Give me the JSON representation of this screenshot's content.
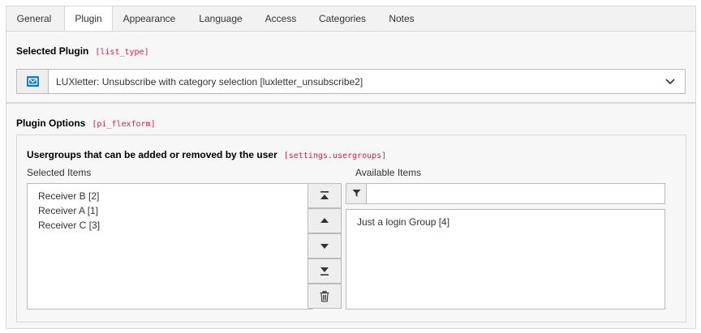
{
  "tabs": [
    {
      "label": "General"
    },
    {
      "label": "Plugin"
    },
    {
      "label": "Appearance"
    },
    {
      "label": "Language"
    },
    {
      "label": "Access"
    },
    {
      "label": "Categories"
    },
    {
      "label": "Notes"
    }
  ],
  "active_tab": "Plugin",
  "selected_plugin": {
    "label": "Selected Plugin",
    "code": "[list_type]",
    "value": "LUXletter: Unsubscribe with category selection [luxletter_unsubscribe2]",
    "icon": "envelope-icon"
  },
  "plugin_options": {
    "label": "Plugin Options",
    "code": "[pi_flexform]",
    "field": {
      "label": "Usergroups that can be added or removed by the user",
      "code": "[settings.usergroups]",
      "selected_label": "Selected Items",
      "selected_items": [
        "Receiver B [2]",
        "Receiver A [1]",
        "Receiver C [3]"
      ],
      "available_label": "Available Items",
      "filter_value": "",
      "available_items": [
        "Just a login Group [4]"
      ],
      "buttons": [
        "move-to-top-icon",
        "move-up-icon",
        "move-down-icon",
        "move-to-bottom-icon",
        "trash-icon"
      ]
    }
  },
  "colors": {
    "code_text": "#c7254e",
    "icon_blue": "#1a7ab8",
    "border": "#bbbbbb",
    "panel_bg": "#f7f7f7"
  }
}
